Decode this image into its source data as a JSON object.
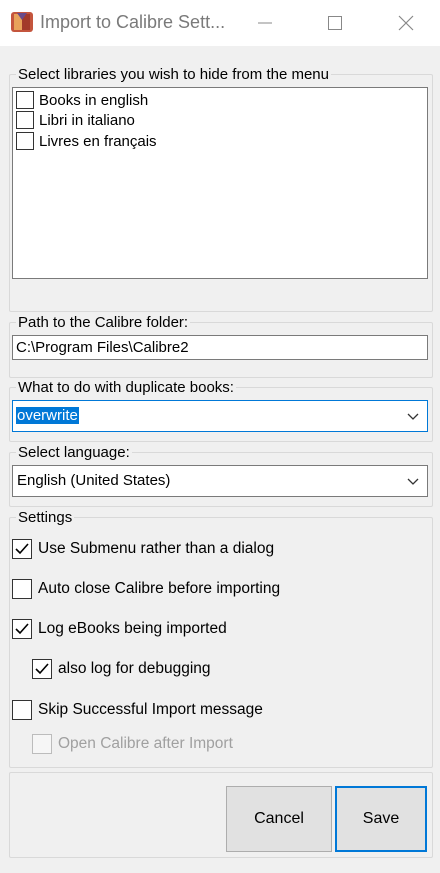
{
  "window": {
    "title": "Import to Calibre Sett...",
    "controls": [
      "minimize",
      "maximize",
      "close"
    ]
  },
  "libraries": {
    "label": "Select libraries you wish to hide from the menu",
    "items": [
      {
        "label": "Books in english",
        "checked": false
      },
      {
        "label": "Libri in italiano",
        "checked": false
      },
      {
        "label": "Livres en français",
        "checked": false
      }
    ]
  },
  "path": {
    "label": "Path to the Calibre folder:",
    "value": "C:\\Program Files\\Calibre2"
  },
  "duplicates": {
    "label": "What to do with duplicate books:",
    "selected": "overwrite"
  },
  "language": {
    "label": "Select language:",
    "selected": "English (United States)"
  },
  "settings": {
    "label": "Settings",
    "use_submenu": {
      "label": "Use Submenu rather than a dialog",
      "checked": true
    },
    "auto_close": {
      "label": "Auto close Calibre before importing",
      "checked": false
    },
    "log_ebooks": {
      "label": "Log eBooks being imported",
      "checked": true
    },
    "log_debug": {
      "label": "also log for debugging",
      "checked": true
    },
    "skip_message": {
      "label": "Skip Successful Import message",
      "checked": false
    },
    "open_after": {
      "label": "Open Calibre after Import",
      "checked": false,
      "disabled": true
    }
  },
  "buttons": {
    "cancel": "Cancel",
    "save": "Save"
  },
  "colors": {
    "accent": "#0078d7",
    "window_bg": "#f0f0f0",
    "icon_red": "#c0392b"
  }
}
